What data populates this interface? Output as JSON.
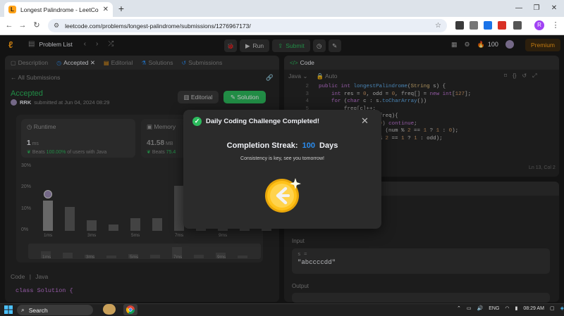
{
  "browser": {
    "tab_title": "Longest Palindrome - LeetCode",
    "url": "leetcode.com/problems/longest-palindrome/submissions/1276967173/",
    "profile_initial": "R"
  },
  "nav": {
    "problem_list": "Problem List",
    "run": "Run",
    "submit": "Submit",
    "coins": "100",
    "premium": "Premium"
  },
  "left_tabs": [
    "Description",
    "Accepted",
    "Editorial",
    "Solutions",
    "Submissions"
  ],
  "submission": {
    "back_label": "All Submissions",
    "status": "Accepted",
    "user": "RRK",
    "submitted_text": "submitted at Jun 04, 2024 08:29",
    "editorial_btn": "Editorial",
    "solution_btn": "Solution",
    "runtime_label": "Runtime",
    "runtime_value": "1",
    "runtime_unit": "ms",
    "runtime_beats_prefix": "Beats",
    "runtime_beats_pct": "100.00%",
    "runtime_beats_suffix": "of users with Java",
    "memory_label": "Memory",
    "memory_value": "41.58",
    "memory_unit": "MB",
    "memory_beats_prefix": "Beats",
    "memory_beats_pct": "75.4",
    "code_tab": "Code",
    "lang_tab": "Java",
    "code_first_line": "class Solution {"
  },
  "chart_data": {
    "type": "bar",
    "y_ticks": [
      "30%",
      "20%",
      "10%",
      "0%"
    ],
    "x_ticks": [
      "1ms",
      "3ms",
      "5ms",
      "7ms",
      "9ms"
    ],
    "mini_x_ticks": [
      "1ms",
      "3ms",
      "5ms",
      "7ms",
      "9ms"
    ],
    "ylim": [
      0,
      30
    ],
    "values": [
      14,
      11,
      5,
      3,
      6,
      6,
      21,
      3,
      5,
      3,
      2
    ],
    "highlight_index": 0,
    "mini_values": [
      0.55,
      0.45,
      0.3,
      0.2,
      0.35,
      0.3,
      0.9,
      0.3,
      0.45,
      0.25
    ]
  },
  "editor": {
    "title": "Code",
    "language": "Java",
    "mode": "Auto",
    "cursor": "Ln 13, Col 2",
    "lines": [
      {
        "n": "2",
        "code": [
          {
            "c": "kw",
            "t": "public "
          },
          {
            "c": "kw",
            "t": "int "
          },
          {
            "c": "fn",
            "t": "longestPalindrome"
          },
          {
            "c": "tx",
            "t": "("
          },
          {
            "c": "ty",
            "t": "String "
          },
          {
            "c": "tx",
            "t": "s) {"
          }
        ]
      },
      {
        "n": "3",
        "code": [
          {
            "c": "tx",
            "t": "    "
          },
          {
            "c": "kw",
            "t": "int "
          },
          {
            "c": "tx",
            "t": "res = "
          },
          {
            "c": "nm",
            "t": "0"
          },
          {
            "c": "tx",
            "t": ", odd = "
          },
          {
            "c": "nm",
            "t": "0"
          },
          {
            "c": "tx",
            "t": ", freq[] = "
          },
          {
            "c": "kw",
            "t": "new "
          },
          {
            "c": "kw",
            "t": "int"
          },
          {
            "c": "tx",
            "t": "["
          },
          {
            "c": "nm",
            "t": "127"
          },
          {
            "c": "tx",
            "t": "];"
          }
        ]
      },
      {
        "n": "4",
        "code": [
          {
            "c": "tx",
            "t": "    "
          },
          {
            "c": "kw",
            "t": "for "
          },
          {
            "c": "tx",
            "t": "("
          },
          {
            "c": "kw",
            "t": "char "
          },
          {
            "c": "tx",
            "t": "c : s."
          },
          {
            "c": "fn",
            "t": "toCharArray"
          },
          {
            "c": "tx",
            "t": "())"
          }
        ]
      },
      {
        "n": "5",
        "code": [
          {
            "c": "tx",
            "t": "        freq[c]++;"
          }
        ]
      },
      {
        "n": "6",
        "code": [
          {
            "c": "tx",
            "t": "    "
          },
          {
            "c": "kw",
            "t": "for "
          },
          {
            "c": "tx",
            "t": "("
          },
          {
            "c": "kw",
            "t": "int "
          },
          {
            "c": "tx",
            "t": "num : freq){"
          }
        ]
      },
      {
        "n": "7",
        "code": [
          {
            "c": "tx",
            "t": "        "
          },
          {
            "c": "kw",
            "t": "if "
          },
          {
            "c": "tx",
            "t": "(num == "
          },
          {
            "c": "nm",
            "t": "0"
          },
          {
            "c": "tx",
            "t": ") "
          },
          {
            "c": "kw",
            "t": "continue"
          },
          {
            "c": "tx",
            "t": ";"
          }
        ]
      },
      {
        "n": "8",
        "code": [
          {
            "c": "tx",
            "t": "        res += num - (num % "
          },
          {
            "c": "nm",
            "t": "2"
          },
          {
            "c": "tx",
            "t": " == "
          },
          {
            "c": "nm",
            "t": "1"
          },
          {
            "c": "tx",
            "t": " ? "
          },
          {
            "c": "nm",
            "t": "1"
          },
          {
            "c": "tx",
            "t": " : "
          },
          {
            "c": "nm",
            "t": "0"
          },
          {
            "c": "tx",
            "t": ");"
          }
        ]
      },
      {
        "n": "9",
        "code": [
          {
            "c": "tx",
            "t": "        odd = (num % "
          },
          {
            "c": "nm",
            "t": "2"
          },
          {
            "c": "tx",
            "t": " == "
          },
          {
            "c": "nm",
            "t": "1"
          },
          {
            "c": "tx",
            "t": " ? "
          },
          {
            "c": "nm",
            "t": "1"
          },
          {
            "c": "tx",
            "t": " : odd);"
          }
        ]
      }
    ]
  },
  "testcase": {
    "input_label": "Input",
    "input_var": "s =",
    "input_value": "\"abccccdd\"",
    "output_label": "Output"
  },
  "modal": {
    "title": "Daily Coding Challenge Completed!",
    "streak_label": "Completion Streak:",
    "streak_value": "100",
    "streak_unit": "Days",
    "subtitle": "Consistency is key, see you tomorrow!"
  },
  "taskbar": {
    "search": "Search",
    "lang": "ENG",
    "time": "08:29 AM"
  },
  "colors": {
    "accent": "#2cbb5d",
    "brand": "#ffa116",
    "streak": "#2b8cee"
  }
}
